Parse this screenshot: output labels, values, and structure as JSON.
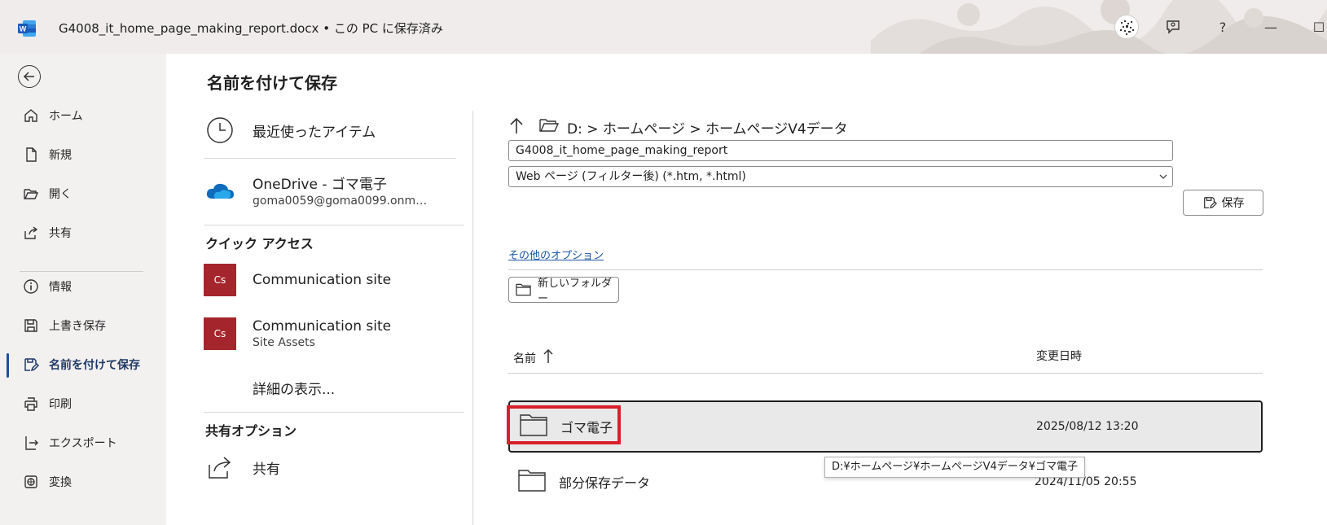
{
  "titlebar": {
    "doc_name": "G4008_it_home_page_making_report.docx",
    "separator": "•",
    "save_status": "この PC に保存済み",
    "help": "?",
    "minimize": "—",
    "maximize": "☐"
  },
  "leftnav": {
    "items": [
      {
        "label": "ホーム",
        "icon": "home-icon"
      },
      {
        "label": "新規",
        "icon": "new-document-icon"
      },
      {
        "label": "開く",
        "icon": "open-folder-icon"
      },
      {
        "label": "共有",
        "icon": "share-icon"
      },
      {
        "label": "情報",
        "icon": "info-icon"
      },
      {
        "label": "上書き保存",
        "icon": "save-icon"
      },
      {
        "label": "名前を付けて保存",
        "icon": "save-as-icon",
        "active": true
      },
      {
        "label": "印刷",
        "icon": "print-icon"
      },
      {
        "label": "エクスポート",
        "icon": "export-icon"
      },
      {
        "label": "変換",
        "icon": "convert-icon"
      }
    ]
  },
  "page": {
    "title": "名前を付けて保存"
  },
  "locations": {
    "recent": "最近使ったアイテム",
    "onedrive_title": "OneDrive - ゴマ電子",
    "onedrive_account": "goma0059@goma0099.onm…",
    "quick_access_heading": "クイック アクセス",
    "cs_abbr": "Cs",
    "cs1_title": "Communication site",
    "cs2_title": "Communication site",
    "cs2_sub": "Site Assets",
    "more": "詳細の表示...",
    "sharing_heading": "共有オプション",
    "share": "共有"
  },
  "right": {
    "breadcrumb": "D: > ホームページ > ホームページV4データ",
    "filename": "G4008_it_home_page_making_report",
    "filetype": "Web ページ (フィルター後) (*.htm, *.html)",
    "save_label": "保存",
    "more_options": "その他のオプション",
    "new_folder": "新しいフォルダー",
    "col_name": "名前",
    "col_date": "変更日時",
    "files": [
      {
        "name": "ゴマ電子",
        "date": "2025/08/12 13:20"
      },
      {
        "name": "部分保存データ",
        "date": "2024/11/05 20:55"
      }
    ],
    "tooltip": "D:¥ホームページ¥ホームページV4データ¥ゴマ電子"
  },
  "colors": {
    "word_blue": "#185abd",
    "accent_nav": "#1f4e9b",
    "cs_tile": "#a4262c",
    "highlight_red": "#d8202a",
    "link": "#1e56a8"
  }
}
